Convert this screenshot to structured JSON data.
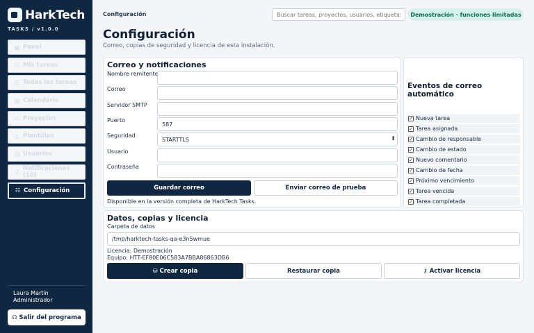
{
  "brand": {
    "name": "HarkTech",
    "version": "TASKS  /  v1.0.0"
  },
  "nav": [
    {
      "label": "Panel",
      "icon": "grid-icon"
    },
    {
      "label": "Mis tareas",
      "icon": "check-icon"
    },
    {
      "label": "Todas las tareas",
      "icon": "list-icon"
    },
    {
      "label": "Calendario",
      "icon": "calendar-icon"
    },
    {
      "label": "Proyectos",
      "icon": "folder-icon"
    },
    {
      "label": "Plantillas",
      "icon": "file-icon"
    },
    {
      "label": "Usuarios",
      "icon": "users-icon"
    },
    {
      "label": "Notificaciones  (10)",
      "icon": "bell-icon"
    },
    {
      "label": "Configuración",
      "icon": "sliders-icon",
      "active": true
    }
  ],
  "user": {
    "name": "Laura Martín",
    "role": "Administrador"
  },
  "logout_label": "Salir del programa",
  "topbar": {
    "breadcrumb": "Configuración",
    "search_placeholder": "Buscar tareas, proyectos, usuarios, etiquetas...",
    "demo_badge": "Demostración · funciones limitadas"
  },
  "page": {
    "title": "Configuración",
    "subtitle": "Correo, copias de seguridad y licencia de esta instalación."
  },
  "mail": {
    "title": "Correo y notificaciones",
    "fields": [
      {
        "label": "Nombre remitente",
        "value": ""
      },
      {
        "label": "Correo",
        "value": ""
      },
      {
        "label": "Servidor SMTP",
        "value": ""
      },
      {
        "label": "Puerto",
        "value": "587"
      },
      {
        "label": "Seguridad",
        "value": "STARTTLS"
      },
      {
        "label": "Usuario",
        "value": ""
      },
      {
        "label": "Contraseña",
        "value": ""
      }
    ],
    "save_label": "Guardar correo",
    "test_label": "Enviar correo de prueba",
    "note": "Disponible en la versión completa de HarkTech Tasks."
  },
  "events": {
    "title": "Eventos de correo automático",
    "items": [
      "Nueva tarea",
      "Tarea asignada",
      "Cambio de responsable",
      "Cambio de estado",
      "Nuevo comentario",
      "Cambio de fecha",
      "Próximo vencimiento",
      "Tarea vencida",
      "Tarea completada"
    ]
  },
  "data_section": {
    "title": "Datos, copias y licencia",
    "folder_label": "Carpeta de datos",
    "folder_value": "/tmp/harktech-tasks-qa-e3n5wmue",
    "license": "Licencia: Demostración",
    "equipment": "Equipo: HTT-EF80E06C583A7BBA86863DB6",
    "backup_label": "Crear copia",
    "restore_label": "Restaurar copia",
    "activate_label": "Activar licencia"
  }
}
